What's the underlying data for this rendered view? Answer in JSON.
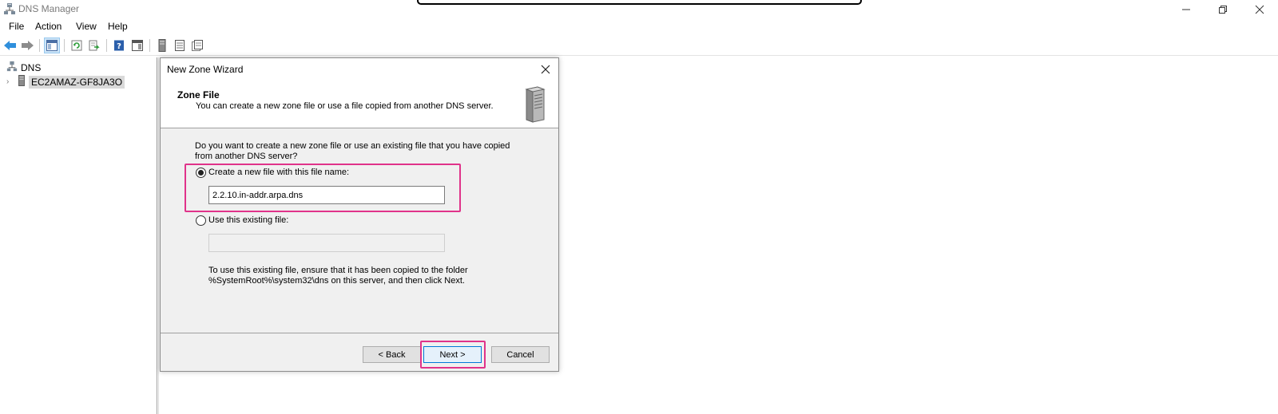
{
  "window": {
    "title": "DNS Manager"
  },
  "menu": {
    "file": "File",
    "action": "Action",
    "view": "View",
    "help": "Help"
  },
  "tree": {
    "root_label": "DNS",
    "server_label": "EC2AMAZ-GF8JA3O"
  },
  "wizard": {
    "title": "New Zone Wizard",
    "header_title": "Zone File",
    "header_subtitle": "You can create a new zone file or use a file copied from another DNS server.",
    "question_line1": "Do you want to create a new zone file or use an existing file that you have copied",
    "question_line2": "from another DNS server?",
    "option_new_label": "Create a new file with this file name:",
    "option_new_value": "2.2.10.in-addr.arpa.dns",
    "option_existing_label": "Use this existing file:",
    "option_existing_value": "",
    "hint_line1": "To use this existing file, ensure that it has been copied to the folder",
    "hint_line2": "%SystemRoot%\\system32\\dns on this server, and then click Next.",
    "back_label": "< Back",
    "next_label": "Next >",
    "cancel_label": "Cancel"
  },
  "colors": {
    "highlight": "#e0338a",
    "default_button_border": "#0078d7",
    "selection": "#d9d9d9"
  },
  "icons": [
    "dns-manager-icon",
    "back-arrow-icon",
    "forward-arrow-icon",
    "show-hide-console-tree-icon",
    "refresh-icon",
    "export-list-icon",
    "help-icon",
    "action-pane-icon",
    "server-icon",
    "list-icon",
    "details-icon",
    "close-icon",
    "minimize-icon",
    "restore-icon"
  ]
}
